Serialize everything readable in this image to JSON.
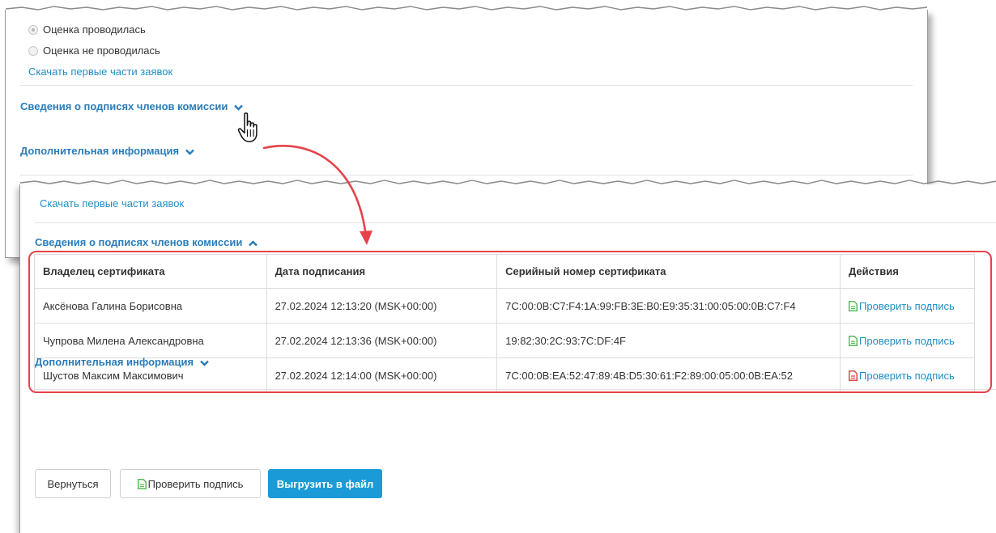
{
  "back_panel": {
    "radio_done_label": "Оценка проводилась",
    "radio_not_done_label": "Оценка не проводилась",
    "download_link": "Скачать первые части заявок",
    "signatures_section": "Сведения о подписях членов комиссии",
    "additional_section": "Дополнительная информация"
  },
  "front_panel": {
    "download_link": "Скачать первые части заявок",
    "signatures_section": "Сведения о подписях членов комиссии",
    "additional_section": "Дополнительная информация",
    "table": {
      "headers": [
        "Владелец сертификата",
        "Дата подписания",
        "Серийный номер сертификата",
        "Действия"
      ],
      "rows": [
        {
          "owner": "Аксёнова Галина Борисовна",
          "date": "27.02.2024 12:13:20 (MSK+00:00)",
          "serial": "7C:00:0B:C7:F4:1A:99:FB:3E:B0:E9:35:31:00:05:00:0B:C7:F4",
          "action": "Проверить подпись",
          "icon": "document-check-icon",
          "icon_color": "#5cb85c"
        },
        {
          "owner": "Чупрова Милена Александровна",
          "date": "27.02.2024 12:13:36 (MSK+00:00)",
          "serial": "19:82:30:2C:93:7C:DF:4F",
          "action": "Проверить подпись",
          "icon": "document-check-icon",
          "icon_color": "#5cb85c"
        },
        {
          "owner": "Шустов Максим Максимович",
          "date": "27.02.2024 12:14:00 (MSK+00:00)",
          "serial": "7C:00:0B:EA:52:47:89:4B:D5:30:61:F2:89:00:05:00:0B:EA:52",
          "action": "Проверить подпись",
          "icon": "document-error-icon",
          "icon_color": "#e5434a"
        }
      ]
    },
    "buttons": {
      "back": "Вернуться",
      "verify": "Проверить подпись",
      "export": "Выгрузить в файл"
    }
  },
  "colors": {
    "link": "#1f8fc5",
    "section_link": "#2a7cb9",
    "primary": "#1a9bd7",
    "highlight": "#e5434a",
    "ok_icon": "#5cb85c"
  }
}
